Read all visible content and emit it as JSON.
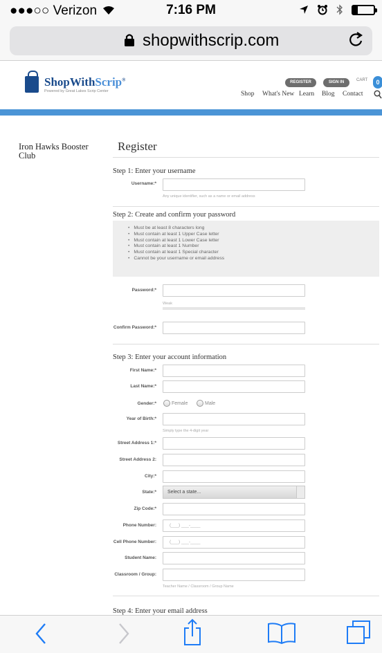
{
  "status_bar": {
    "carrier": "●●●○○ Verizon",
    "time": "7:16 PM"
  },
  "browser": {
    "url": "shopwithscrip.com"
  },
  "site": {
    "logo_main": "ShopWith",
    "logo_accent": "Scrip",
    "logo_mark": "®",
    "tagline": "Powered by Great Lakes Scrip Center",
    "register_btn": "REGISTER",
    "signin_btn": "SIGN IN",
    "cart_label": "CART",
    "cart_count": "0",
    "nav": [
      "Shop",
      "What's New",
      "Learn",
      "Blog",
      "Contact"
    ]
  },
  "sidebar": {
    "organization": "Iron Hawks Booster Club"
  },
  "form": {
    "title": "Register",
    "step1": {
      "heading": "Step 1: Enter your username",
      "username_label": "Username:*",
      "username_hint": "Any unique identifier, such as a name or email address"
    },
    "step2": {
      "heading": "Step 2: Create and confirm your password",
      "rules": [
        "Must be at least 8 characters long",
        "Must contain at least 1 Upper Case letter",
        "Must contain at least 1 Lower Case letter",
        "Must contain at least 1 Number",
        "Must contain at least 1 Special character",
        "Cannot be your username or email address"
      ],
      "password_label": "Password:*",
      "strength": "Weak",
      "confirm_label": "Confirm Password:*"
    },
    "step3": {
      "heading": "Step 3: Enter your account information",
      "first_name": "First Name:*",
      "last_name": "Last Name:*",
      "gender": "Gender:*",
      "gender_female": "Female",
      "gender_male": "Male",
      "year_of_birth": "Year of Birth:*",
      "year_hint": "Simply type the 4-digit year",
      "street1": "Street Address 1:*",
      "street2": "Street Address 2:",
      "city": "City:*",
      "state": "State:*",
      "state_placeholder": "Select a state...",
      "zip": "Zip Code:*",
      "phone": "Phone Number:",
      "phone_placeholder": "(___) ___-____",
      "cell": "Cell Phone Number:",
      "cell_placeholder": "(___) ___-____",
      "student": "Student Name:",
      "classroom": "Classroom / Group:",
      "classroom_hint": "Teacher Name / Classroom / Group Name"
    },
    "step4": {
      "heading": "Step 4: Enter your email address"
    }
  },
  "colors": {
    "brand_blue": "#1a4b8c",
    "accent_blue": "#4b94d6",
    "ios_blue": "#1e7cf6"
  }
}
